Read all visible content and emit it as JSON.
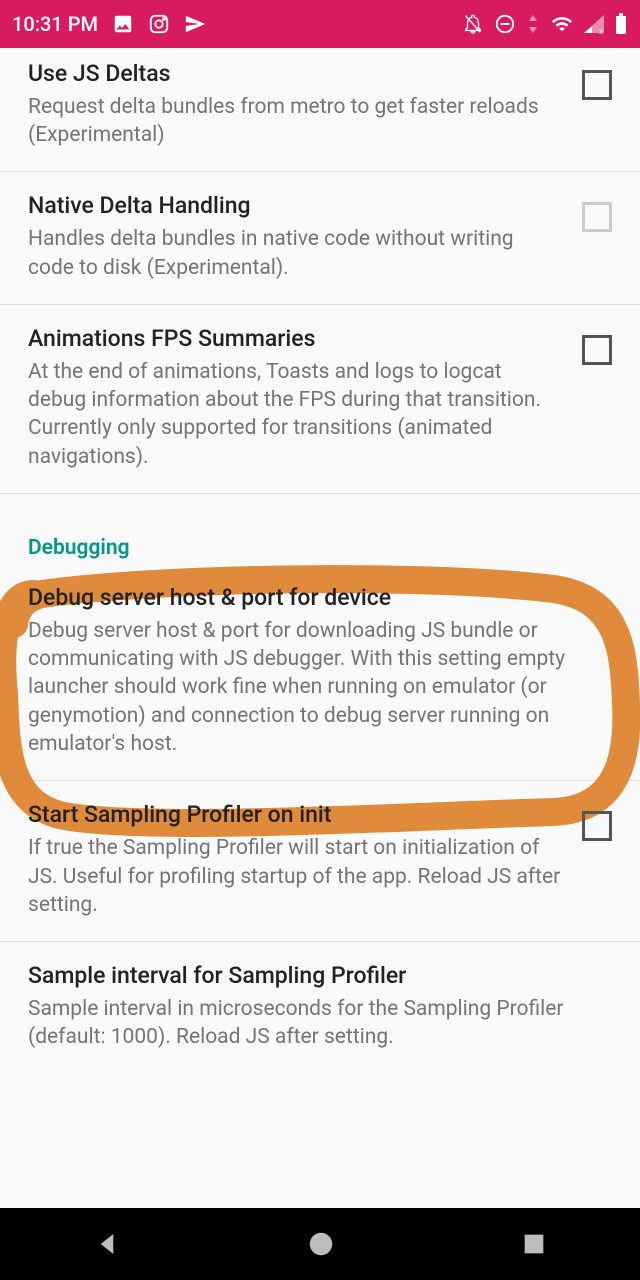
{
  "status": {
    "time": "10:31 PM"
  },
  "section": {
    "debugging": "Debugging"
  },
  "settings": {
    "jsdeltas": {
      "title": "Use JS Deltas",
      "desc": "Request delta bundles from metro to get faster reloads (Experimental)"
    },
    "nativedelta": {
      "title": "Native Delta Handling",
      "desc": "Handles delta bundles in native code without writing code to disk (Experimental)."
    },
    "fps": {
      "title": "Animations FPS Summaries",
      "desc": "At the end of animations, Toasts and logs to logcat debug information about the FPS during that transition. Currently only supported for transitions (animated navigations)."
    },
    "debugserver": {
      "title": "Debug server host & port for device",
      "desc": "Debug server host & port for downloading JS bundle or communicating with JS debugger. With this setting empty launcher should work fine when running on emulator (or genymotion) and connection to debug server running on emulator's host."
    },
    "profiler": {
      "title": "Start Sampling Profiler on init",
      "desc": "If true the Sampling Profiler will start on initialization of JS. Useful for profiling startup of the app. Reload JS after setting."
    },
    "interval": {
      "title": "Sample interval for Sampling Profiler",
      "desc": "Sample interval in microseconds for the Sampling Profiler (default: 1000). Reload JS after setting."
    }
  }
}
